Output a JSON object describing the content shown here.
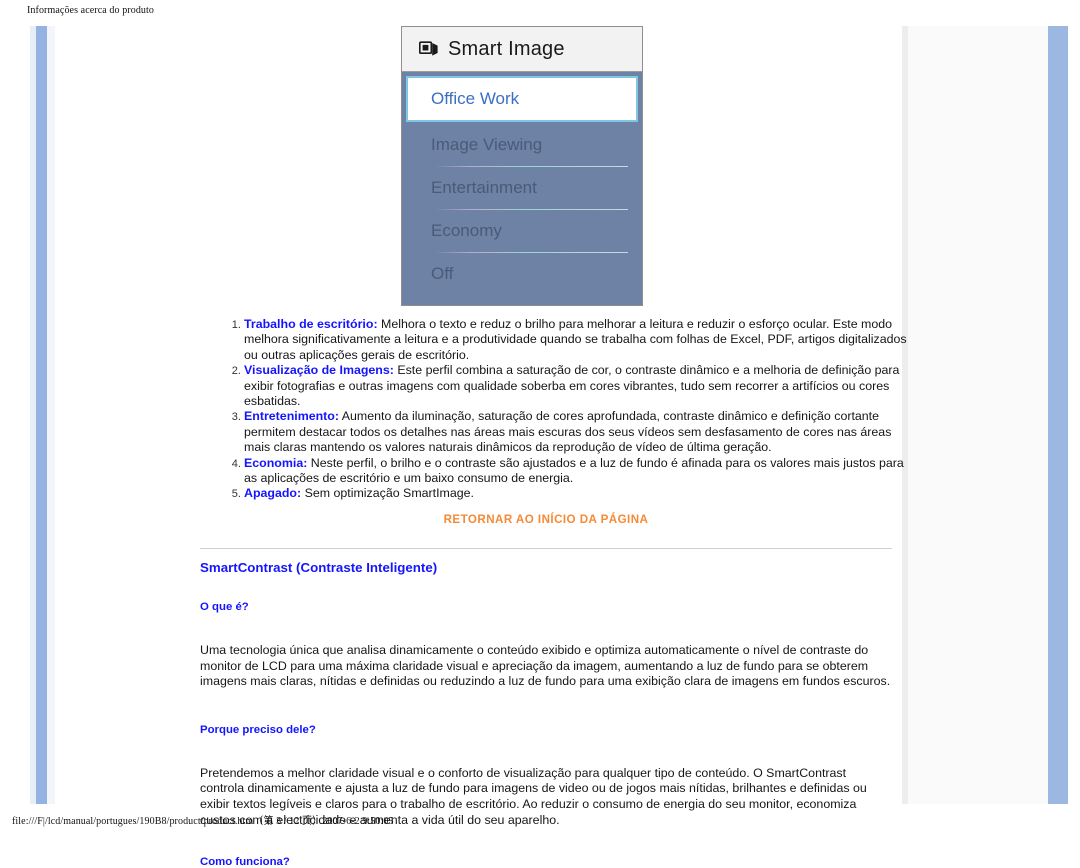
{
  "browser": {
    "print_header": "Informações acerca do produto",
    "print_footer": "file:///F|/lcd/manual/portugues/190B8/product/product.htm（第 3 / 12 页）2007-6-2 9:50:05"
  },
  "osd": {
    "title": "Smart Image",
    "title_icon": "smart-image-icon",
    "items": [
      {
        "label": "Office Work",
        "selected": true
      },
      {
        "label": "Image Viewing",
        "selected": false
      },
      {
        "label": "Entertainment",
        "selected": false
      },
      {
        "label": "Economy",
        "selected": false
      },
      {
        "label": "Off",
        "selected": false
      }
    ]
  },
  "features": [
    {
      "term": "Trabalho de escritório:",
      "text": " Melhora o texto e reduz o brilho para melhorar a leitura e reduzir o esforço ocular. Este modo melhora significativamente a leitura e a produtividade quando se trabalha com folhas de Excel, PDF, artigos digitalizados ou outras aplicações gerais de escritório."
    },
    {
      "term": "Visualização de Imagens:",
      "text": " Este perfil combina a saturação de cor, o contraste dinâmico e a melhoria de definição para exibir fotografias e outras imagens com qualidade soberba em cores vibrantes, tudo sem recorrer a artifícios ou cores esbatidas."
    },
    {
      "term": "Entretenimento:",
      "text": " Aumento da iluminação, saturação de cores aprofundada, contraste dinâmico e definição cortante permitem destacar todos os detalhes nas áreas mais escuras dos seus vídeos sem desfasamento de cores nas áreas mais claras mantendo os valores naturais dinâmicos da reprodução de vídeo de última geração."
    },
    {
      "term": "Economia:",
      "text": " Neste perfil, o brilho e o contraste são ajustados e a luz de fundo é afinada para os valores mais justos para as aplicações de escritório e um baixo consumo de energia."
    },
    {
      "term": "Apagado:",
      "text": " Sem optimização SmartImage."
    }
  ],
  "return_link": {
    "label": "RETORNAR AO INÍCIO DA PÁGINA",
    "color": "#f58a36"
  },
  "smartcontrast": {
    "heading": "SmartContrast (Contraste Inteligente)",
    "what_is_it": {
      "heading": "O que é?",
      "body": "Uma tecnologia única que analisa dinamicamente o conteúdo exibido e optimiza automaticamente o nível de contraste do monitor de LCD para uma máxima claridade visual e apreciação da imagem, aumentando a luz de fundo para se obterem imagens mais claras, nítidas e definidas ou reduzindo a luz de fundo para uma exibição clara de imagens em fundos escuros."
    },
    "why_need_it": {
      "heading": "Porque preciso dele?",
      "body": "Pretendemos a melhor claridade visual e o conforto de visualização para qualquer tipo de conteúdo. O SmartContrast controla dinamicamente e ajusta a luz de fundo para imagens de video ou de jogos mais nítidas, brilhantes e definidas ou exibir textos legíveis e claros para o trabalho de escritório. Ao reduzir o consumo de energia do seu monitor, economiza custos com a electricidade e aumenta a vida útil do seu aparelho."
    },
    "how_it_works": {
      "heading": "Como funciona?"
    }
  },
  "colors": {
    "link_heading": "#1414ff",
    "return_link": "#f58a36",
    "osd_panel": "#6e82a6",
    "osd_selected_text": "#3b6fc4",
    "osd_selected_border": "#7ec8e3"
  }
}
